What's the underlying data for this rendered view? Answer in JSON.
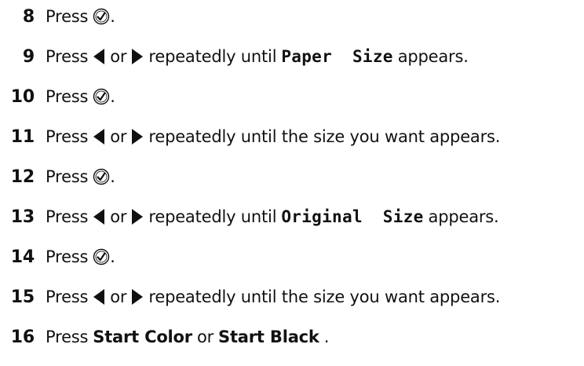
{
  "steps": [
    {
      "number": "8",
      "parts": {
        "press": "Press",
        "end": "."
      }
    },
    {
      "number": "9",
      "parts": {
        "press": "Press",
        "or": "or",
        "mid": "repeatedly until",
        "code": "Paper  Size",
        "end": "appears."
      }
    },
    {
      "number": "10",
      "parts": {
        "press": "Press",
        "end": "."
      }
    },
    {
      "number": "11",
      "parts": {
        "press": "Press",
        "or": "or",
        "mid": "repeatedly until the size you want appears."
      }
    },
    {
      "number": "12",
      "parts": {
        "press": "Press",
        "end": "."
      }
    },
    {
      "number": "13",
      "parts": {
        "press": "Press",
        "or": "or",
        "mid": "repeatedly until",
        "code": "Original  Size",
        "end": "appears."
      }
    },
    {
      "number": "14",
      "parts": {
        "press": "Press",
        "end": "."
      }
    },
    {
      "number": "15",
      "parts": {
        "press": "Press",
        "or": "or",
        "mid": "repeatedly until the size you want appears."
      }
    },
    {
      "number": "16",
      "parts": {
        "press": "Press",
        "btn1": "Start Color",
        "or": "or",
        "btn2": "Start Black",
        "end": "."
      }
    }
  ],
  "icons": {
    "select": "check-icon",
    "left": "left-arrow-icon",
    "right": "right-arrow-icon"
  }
}
